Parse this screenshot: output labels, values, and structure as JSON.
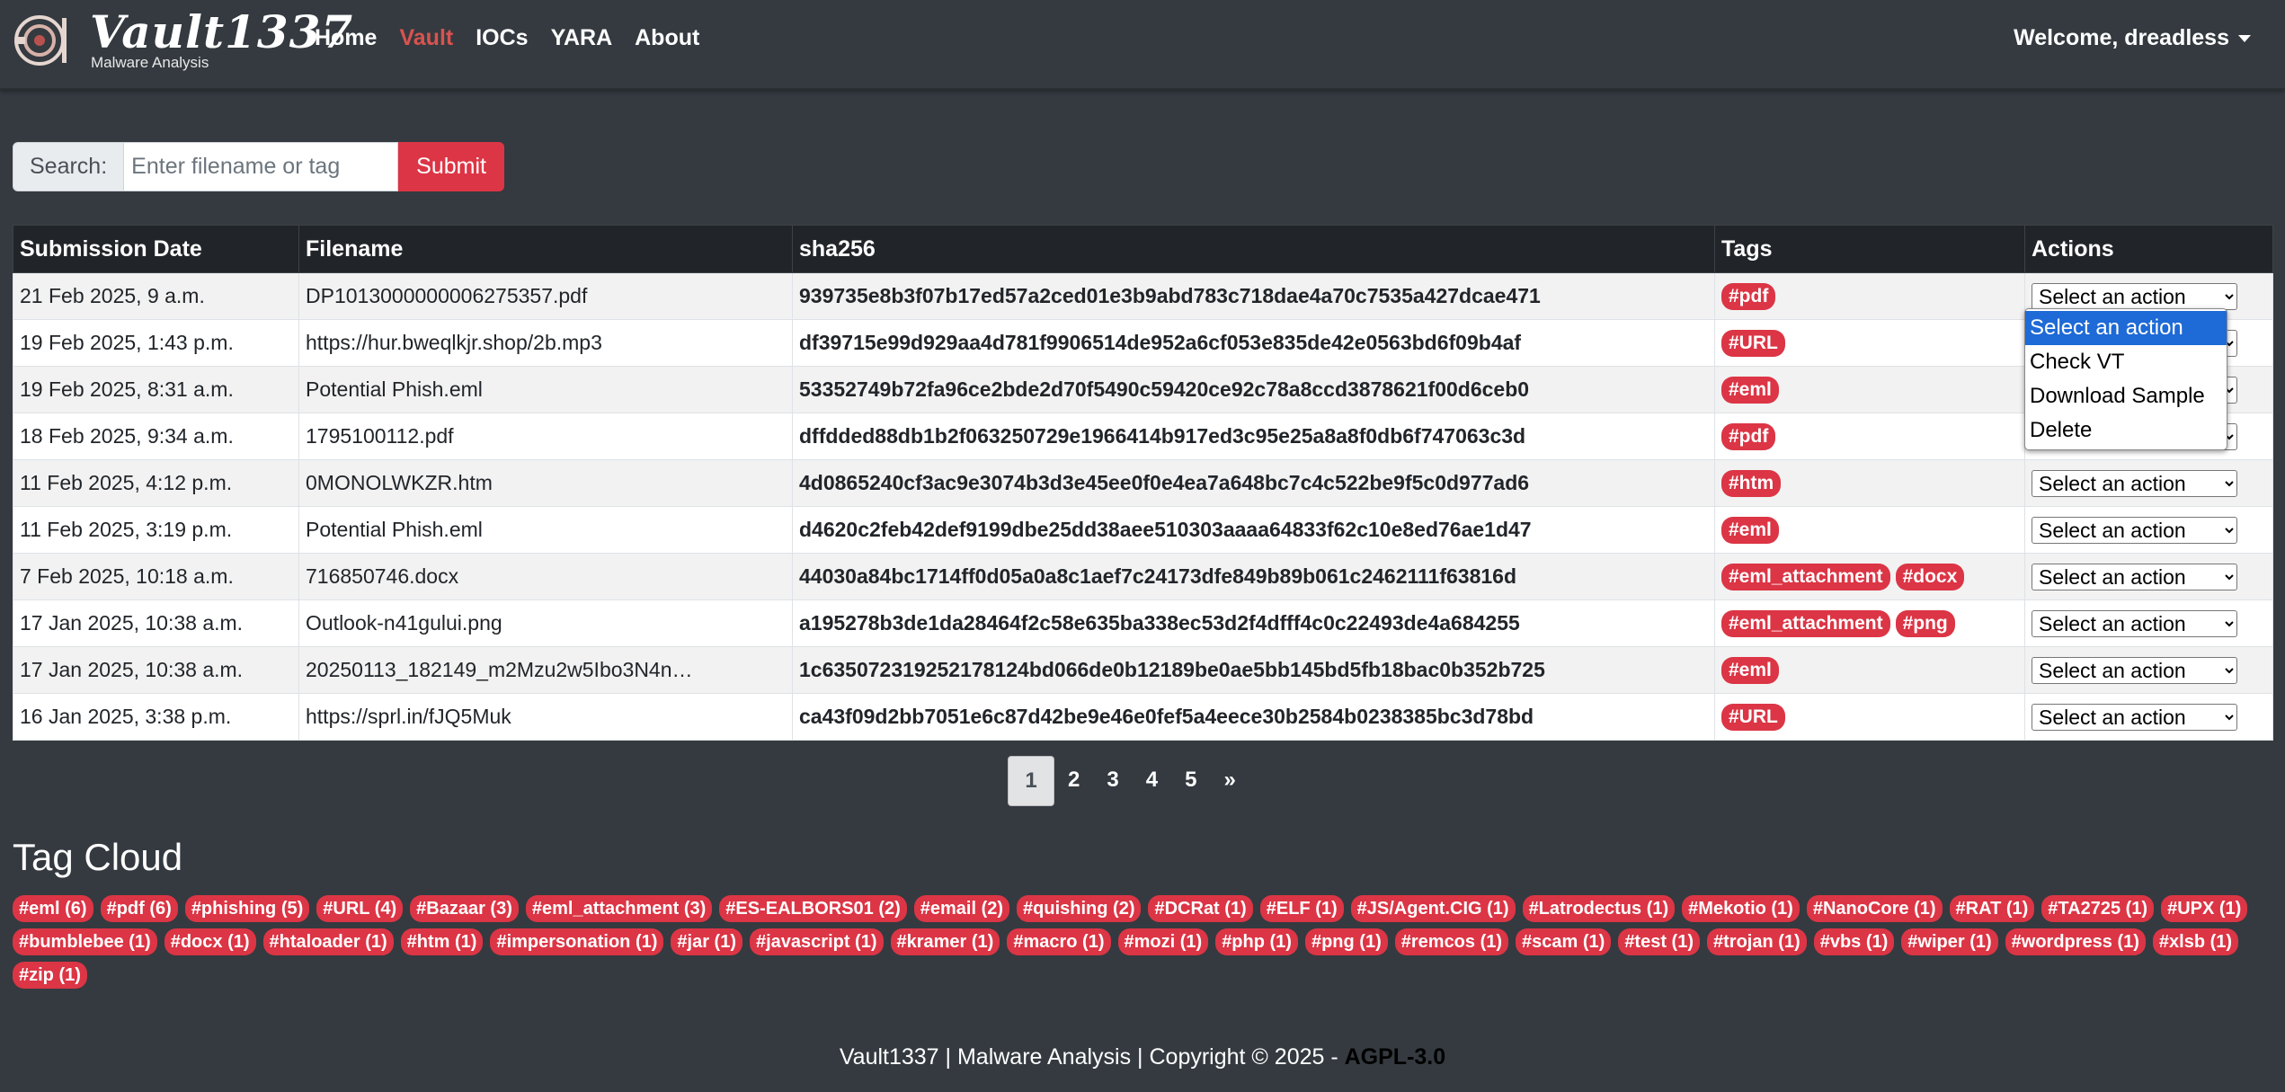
{
  "brand": {
    "name": "Vault1337",
    "subtitle": "Malware Analysis"
  },
  "nav": [
    {
      "label": "Home",
      "active": false
    },
    {
      "label": "Vault",
      "active": true
    },
    {
      "label": "IOCs",
      "active": false
    },
    {
      "label": "YARA",
      "active": false
    },
    {
      "label": "About",
      "active": false
    }
  ],
  "user": {
    "welcome": "Welcome, dreadless"
  },
  "search": {
    "label": "Search:",
    "placeholder": "Enter filename or tag",
    "submit": "Submit"
  },
  "table": {
    "headers": [
      "Submission Date",
      "Filename",
      "sha256",
      "Tags",
      "Actions"
    ],
    "rows": [
      {
        "date": "21 Feb 2025, 9 a.m.",
        "filename": "DP1013000000006275357.pdf",
        "sha256": "939735e8b3f07b17ed57a2ced01e3b9abd783c718dae4a70c7535a427dcae471",
        "tags": [
          "#pdf"
        ]
      },
      {
        "date": "19 Feb 2025, 1:43 p.m.",
        "filename": "https://hur.bweqlkjr.shop/2b.mp3",
        "sha256": "df39715e99d929aa4d781f9906514de952a6cf053e835de42e0563bd6f09b4af",
        "tags": [
          "#URL"
        ]
      },
      {
        "date": "19 Feb 2025, 8:31 a.m.",
        "filename": "Potential Phish.eml",
        "sha256": "53352749b72fa96ce2bde2d70f5490c59420ce92c78a8ccd3878621f00d6ceb0",
        "tags": [
          "#eml"
        ]
      },
      {
        "date": "18 Feb 2025, 9:34 a.m.",
        "filename": "1795100112.pdf",
        "sha256": "dffdded88db1b2f063250729e1966414b917ed3c95e25a8a8f0db6f747063c3d",
        "tags": [
          "#pdf"
        ]
      },
      {
        "date": "11 Feb 2025, 4:12 p.m.",
        "filename": "0MONOLWKZR.htm",
        "sha256": "4d0865240cf3ac9e3074b3d3e45ee0f0e4ea7a648bc7c4c522be9f5c0d977ad6",
        "tags": [
          "#htm"
        ]
      },
      {
        "date": "11 Feb 2025, 3:19 p.m.",
        "filename": "Potential Phish.eml",
        "sha256": "d4620c2feb42def9199dbe25dd38aee510303aaaa64833f62c10e8ed76ae1d47",
        "tags": [
          "#eml"
        ]
      },
      {
        "date": "7 Feb 2025, 10:18 a.m.",
        "filename": "716850746.docx",
        "sha256": "44030a84bc1714ff0d05a0a8c1aef7c24173dfe849b89b061c2462111f63816d",
        "tags": [
          "#eml_attachment",
          "#docx"
        ]
      },
      {
        "date": "17 Jan 2025, 10:38 a.m.",
        "filename": "Outlook-n41gului.png",
        "sha256": "a195278b3de1da28464f2c58e635ba338ec53d2f4dfff4c0c22493de4a684255",
        "tags": [
          "#eml_attachment",
          "#png"
        ]
      },
      {
        "date": "17 Jan 2025, 10:38 a.m.",
        "filename": "20250113_182149_m2Mzu2w5Ibo3N4n…",
        "sha256": "1c635072319252178124bd066de0b12189be0ae5bb145bd5fb18bac0b352b725",
        "tags": [
          "#eml"
        ]
      },
      {
        "date": "16 Jan 2025, 3:38 p.m.",
        "filename": "https://sprl.in/fJQ5Muk",
        "sha256": "ca43f09d2bb7051e6c87d42be9e46e0fef5a4eece30b2584b0238385bc3d78bd",
        "tags": [
          "#URL"
        ]
      }
    ]
  },
  "actions": {
    "placeholder": "Select an action",
    "options": [
      "Select an action",
      "Check VT",
      "Download Sample",
      "Delete"
    ],
    "open_row": 0
  },
  "pagination": {
    "pages": [
      "1",
      "2",
      "3",
      "4",
      "5"
    ],
    "current": "1",
    "next": "»"
  },
  "tag_cloud": {
    "title": "Tag Cloud",
    "tags": [
      "#eml (6)",
      "#pdf (6)",
      "#phishing (5)",
      "#URL (4)",
      "#Bazaar (3)",
      "#eml_attachment (3)",
      "#ES-EALBORS01 (2)",
      "#email (2)",
      "#quishing (2)",
      "#DCRat (1)",
      "#ELF (1)",
      "#JS/Agent.CIG (1)",
      "#Latrodectus (1)",
      "#Mekotio (1)",
      "#NanoCore (1)",
      "#RAT (1)",
      "#TA2725 (1)",
      "#UPX (1)",
      "#bumblebee (1)",
      "#docx (1)",
      "#htaloader (1)",
      "#htm (1)",
      "#impersonation (1)",
      "#jar (1)",
      "#javascript (1)",
      "#kramer (1)",
      "#macro (1)",
      "#mozi (1)",
      "#php (1)",
      "#png (1)",
      "#remcos (1)",
      "#scam (1)",
      "#test (1)",
      "#trojan (1)",
      "#vbs (1)",
      "#wiper (1)",
      "#wordpress (1)",
      "#xlsb (1)",
      "#zip (1)"
    ]
  },
  "footer": {
    "text": "Vault1337 | Malware Analysis | Copyright © 2025 - ",
    "license": "AGPL-3.0"
  },
  "colors": {
    "background": "#343a40",
    "accent": "#dc3545",
    "table_header": "#212529",
    "dropdown_highlight": "#1e6ad6"
  }
}
